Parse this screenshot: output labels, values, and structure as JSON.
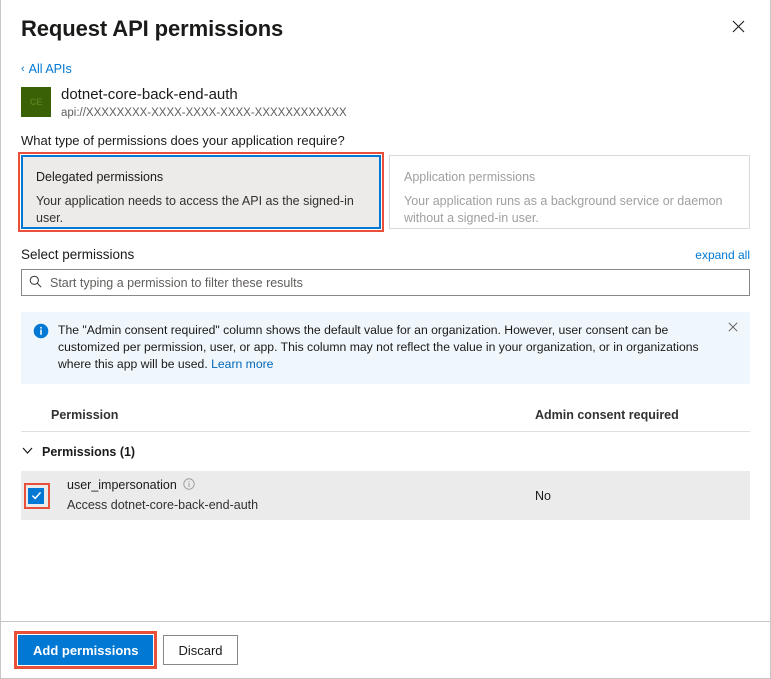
{
  "header": {
    "title": "Request API permissions",
    "close_icon": "close-icon"
  },
  "breadcrumb": {
    "back_label": "All APIs",
    "chevron": "‹"
  },
  "api": {
    "icon_text": "CE",
    "name": "dotnet-core-back-end-auth",
    "uri": "api://XXXXXXXX-XXXX-XXXX-XXXX-XXXXXXXXXXXX"
  },
  "permission_type": {
    "question": "What type of permissions does your application require?",
    "options": [
      {
        "title": "Delegated permissions",
        "description": "Your application needs to access the API as the signed-in user.",
        "selected": true,
        "disabled": false
      },
      {
        "title": "Application permissions",
        "description": "Your application runs as a background service or daemon without a signed-in user.",
        "selected": false,
        "disabled": true
      }
    ]
  },
  "select_permissions": {
    "title": "Select permissions",
    "expand_all": "expand all",
    "search_placeholder": "Start typing a permission to filter these results",
    "search_value": "",
    "search_icon": "search-icon"
  },
  "info_banner": {
    "icon": "info-icon",
    "text": "The \"Admin consent required\" column shows the default value for an organization. However, user consent can be customized per permission, user, or app. This column may not reflect the value in your organization, or in organizations where this app will be used. ",
    "link_label": "Learn more",
    "close_icon": "close-icon",
    "background": "#eff6fc"
  },
  "table": {
    "columns": [
      "Permission",
      "Admin consent required"
    ],
    "group": {
      "label": "Permissions (1)",
      "expanded": true,
      "chevron_icon": "chevron-down-icon"
    },
    "rows": [
      {
        "checked": true,
        "name": "user_impersonation",
        "info_icon": "info-circle-icon",
        "description": "Access dotnet-core-back-end-auth",
        "admin_consent_required": "No"
      }
    ]
  },
  "footer": {
    "primary_label": "Add permissions",
    "secondary_label": "Discard"
  },
  "colors": {
    "accent": "#0078d4",
    "annotation": "#e8503a",
    "icon_background": "#3a6106",
    "row_selected_background": "#ebebeb"
  }
}
